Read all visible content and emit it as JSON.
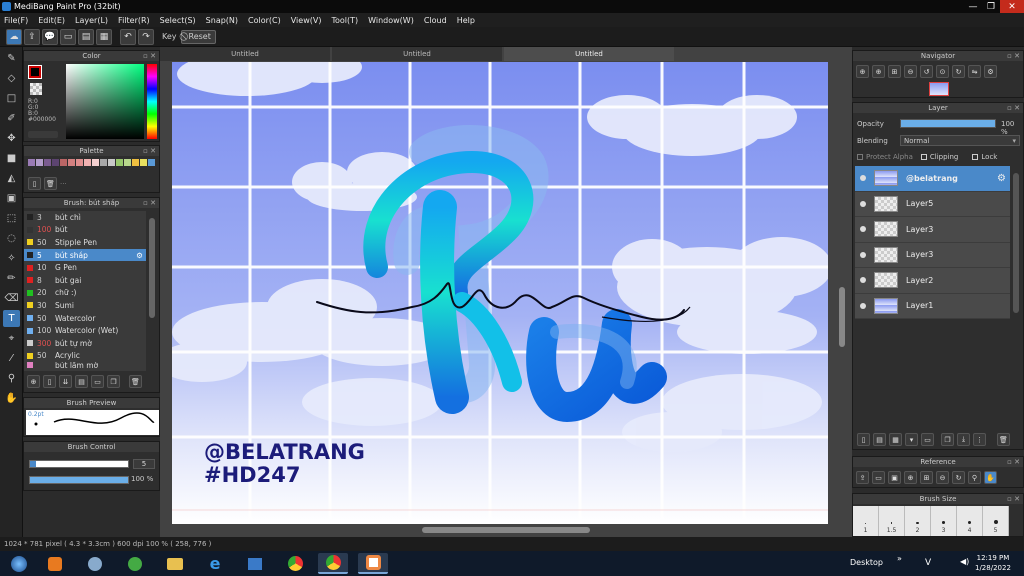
{
  "window": {
    "title": "MediBang Paint Pro (32bit)",
    "min": "—",
    "max": "❐",
    "close": "✕"
  },
  "menu": [
    "File(F)",
    "Edit(E)",
    "Layer(L)",
    "Filter(R)",
    "Select(S)",
    "Snap(N)",
    "Color(C)",
    "View(V)",
    "Tool(T)",
    "Window(W)",
    "Cloud",
    "Help"
  ],
  "toolbar": {
    "key_label": "Key",
    "reset_label": "Reset"
  },
  "tabs": [
    "Untitled",
    "Untitled",
    "Untitled"
  ],
  "color_panel": {
    "title": "Color",
    "r": "R:0",
    "g": "G:0",
    "b": "B:0",
    "hex": "#000000",
    "main_color": "#000000"
  },
  "palette": {
    "title": "Palette",
    "colors": [
      "#9a7bb5",
      "#b39dcb",
      "#7a5b8f",
      "#5c4470",
      "#bb6666",
      "#d38080",
      "#e08f8f",
      "#f0b0b0",
      "#f5d0d0",
      "#a8a8a8",
      "#c8c8c8",
      "#98c86c",
      "#b8d88c",
      "#f0c040",
      "#e8e060",
      "#5a9ad8"
    ]
  },
  "brush": {
    "title": "Brush: bút sháp",
    "items": [
      {
        "size": "3",
        "name": "bút chì",
        "color": "#222222"
      },
      {
        "size": "100",
        "name": "bút",
        "color": "#333333"
      },
      {
        "size": "50",
        "name": "Stipple Pen",
        "color": "#f0d020"
      },
      {
        "size": "5",
        "name": "bút sháp",
        "color": "#222222"
      },
      {
        "size": "10",
        "name": "G Pen",
        "color": "#e02020"
      },
      {
        "size": "8",
        "name": "bút gai",
        "color": "#e02020"
      },
      {
        "size": "20",
        "name": "chữ :)",
        "color": "#20c020"
      },
      {
        "size": "30",
        "name": "Sumi",
        "color": "#f0d020"
      },
      {
        "size": "50",
        "name": "Watercolor",
        "color": "#70b0f0"
      },
      {
        "size": "100",
        "name": "Watercolor (Wet)",
        "color": "#70b0f0"
      },
      {
        "size": "300",
        "name": "bút tự mờ",
        "color": "#cccccc"
      },
      {
        "size": "50",
        "name": "Acrylic",
        "color": "#f0d020"
      }
    ],
    "partial_item": "bút lấm mờ"
  },
  "brush_preview": {
    "title": "Brush Preview",
    "size_label": "0.2pt"
  },
  "brush_control": {
    "title": "Brush Control",
    "size_value": "5",
    "opacity_value": "100 %"
  },
  "navigator": {
    "title": "Navigator"
  },
  "layer": {
    "title": "Layer",
    "opacity_label": "Opacity",
    "opacity_value": "100 %",
    "blending_label": "Blending",
    "blending_value": "Normal",
    "protect_alpha": "Protect Alpha",
    "clipping": "Clipping",
    "lock": "Lock",
    "layers": [
      "@belatrang",
      "Layer5",
      "Layer3",
      "Layer3",
      "Layer2",
      "Layer1"
    ]
  },
  "reference": {
    "title": "Reference"
  },
  "brush_size": {
    "title": "Brush Size",
    "sizes": [
      "1",
      "1.5",
      "2",
      "3",
      "4",
      "5"
    ]
  },
  "artwork": {
    "letters": "Ru",
    "watermark_line1": "@BELATRANG",
    "watermark_line2": "#HD247"
  },
  "status": {
    "text": "1024 * 781 pixel   ( 4.3 * 3.3cm )   600 dpi   100 %   ( 258, 776 )"
  },
  "taskbar": {
    "desktop_label": "Desktop",
    "lang": "V",
    "time": "12:19 PM",
    "date": "1/28/2022"
  }
}
